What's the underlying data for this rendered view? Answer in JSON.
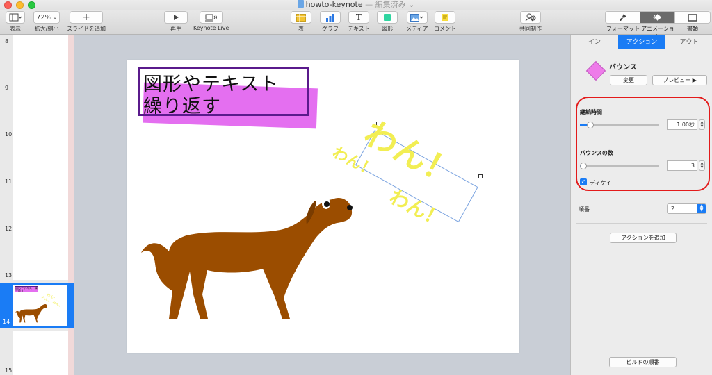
{
  "window": {
    "title": "howto-keynote",
    "status": " — 編集済み ⌄"
  },
  "toolbar": {
    "view_label": "表示",
    "zoom_value": "72%",
    "zoom_label": "拡大/縮小",
    "add_slide_label": "スライドを追加",
    "play_label": "再生",
    "keynote_live_label": "Keynote Live",
    "table_label": "表",
    "chart_label": "グラフ",
    "text_label": "テキスト",
    "shape_label": "図形",
    "media_label": "メディア",
    "comment_label": "コメント",
    "collaborate_label": "共同制作",
    "format_label": "フォーマット",
    "animate_label": "アニメーション",
    "document_label": "書類"
  },
  "navigator": {
    "slide_numbers": [
      "8",
      "9",
      "10",
      "11",
      "12",
      "13",
      "14",
      "15"
    ],
    "thumbnail": {
      "title_text": "図形やテキスト繰り返す",
      "wan_texts": [
        "わん！",
        "わん！",
        "わん！"
      ]
    }
  },
  "slide": {
    "title_line1": "図形やテキスト",
    "title_line2": "繰り返す",
    "wan_big": "わん！",
    "wan_small_left": "わん！",
    "wan_small_right": "わん！",
    "colors": {
      "highlight": "#e46ff0",
      "frame": "#5a1a8c",
      "wan_text": "#f2ee53",
      "dog": "#9b4d00"
    }
  },
  "inspector": {
    "tabs": [
      {
        "label": "イン",
        "active": false
      },
      {
        "label": "アクション",
        "active": true
      },
      {
        "label": "アウト",
        "active": false
      }
    ],
    "effect_name": "バウンス",
    "change_button": "変更",
    "preview_button": "プレビュー ▶",
    "duration_label": "継続時間",
    "duration_value": "1.00秒",
    "duration_level": 0.1,
    "bounce_count_label": "バウンスの数",
    "bounce_count_value": "3",
    "bounce_count_level": 0.0,
    "decay_label": "ディケイ",
    "decay_checked": true,
    "order_label": "順番",
    "order_value": "2",
    "add_action_button": "アクションを追加",
    "build_order_button": "ビルドの順番",
    "accent_color": "#1a7cf5",
    "ring_color": "#e31a1a"
  }
}
